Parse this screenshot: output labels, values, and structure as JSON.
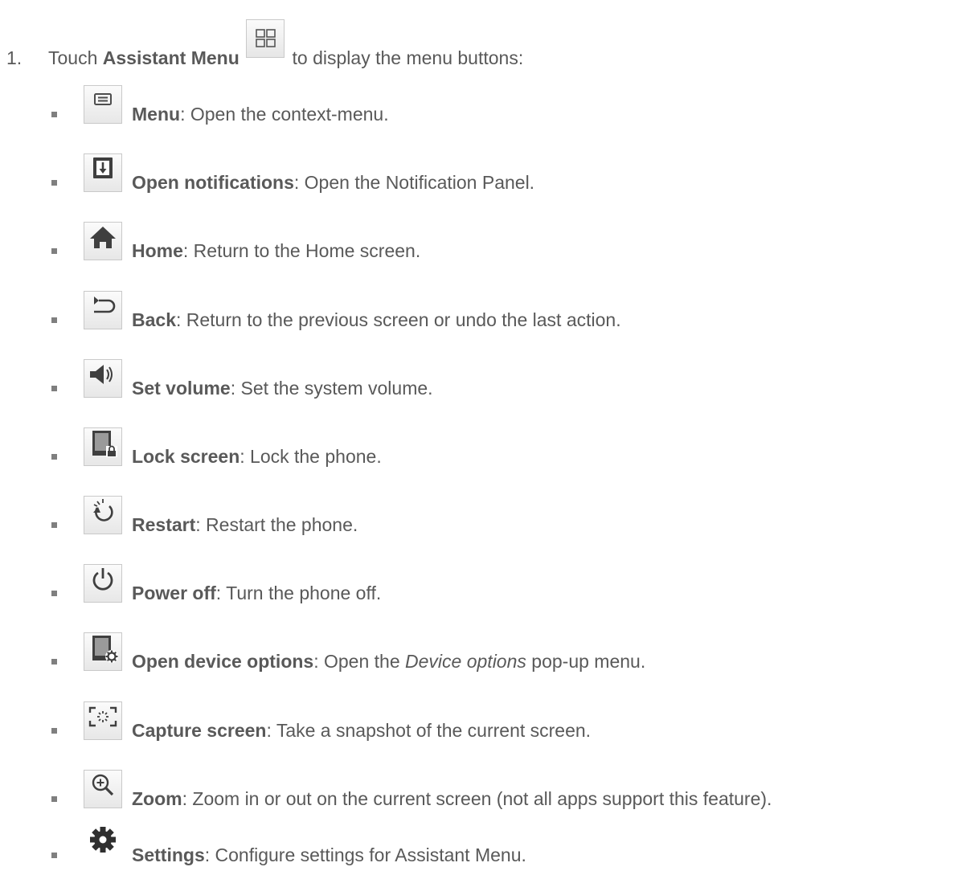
{
  "step": {
    "number": "1.",
    "prefix": "Touch",
    "bold": "Assistant Menu",
    "icon": "assistant-menu-grid-icon",
    "suffix": "to display the menu buttons:"
  },
  "items": [
    {
      "icon": "menu-icon",
      "bold": "Menu",
      "text": ": Open the context-menu."
    },
    {
      "icon": "open-notifications-icon",
      "bold": "Open notifications",
      "text": ": Open the Notification Panel."
    },
    {
      "icon": "home-icon",
      "bold": "Home",
      "text": ": Return to the Home screen."
    },
    {
      "icon": "back-icon",
      "bold": "Back",
      "text": ": Return to the previous screen or undo the last action."
    },
    {
      "icon": "volume-icon",
      "bold": "Set volume",
      "text": ": Set the system volume."
    },
    {
      "icon": "lock-screen-icon",
      "bold": "Lock screen",
      "text": ": Lock the phone."
    },
    {
      "icon": "restart-icon",
      "bold": "Restart",
      "text": ": Restart the phone."
    },
    {
      "icon": "power-icon",
      "bold": "Power off",
      "text": ": Turn the phone off."
    },
    {
      "icon": "device-options-icon",
      "bold": "Open device options",
      "text": ": Open the ",
      "italic": "Device options",
      "text_after": " pop-up menu."
    },
    {
      "icon": "capture-screen-icon",
      "bold": "Capture screen",
      "text": ": Take a snapshot of the current screen."
    },
    {
      "icon": "zoom-icon",
      "bold": "Zoom",
      "text": ": Zoom in or out on the current screen (not all apps support this feature)."
    },
    {
      "icon": "gear-icon",
      "bold": "Settings",
      "text": ": Configure settings for Assistant Menu."
    }
  ],
  "colors": {
    "text": "#595959",
    "icon": "#4d4d4d",
    "bullet": "#7f7f7f",
    "icon_border": "#c9c9c9"
  }
}
